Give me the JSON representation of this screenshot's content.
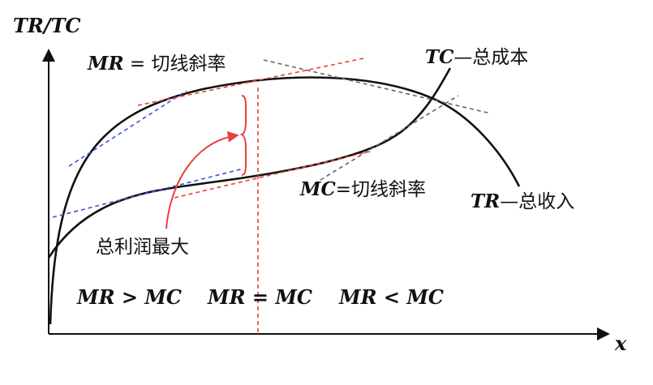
{
  "axes": {
    "y_label": "TR/TC",
    "x_label": "x"
  },
  "curves": {
    "tc_label_sym": "TC",
    "tc_label_text": "—总成本",
    "tr_label_sym": "TR",
    "tr_label_text": "—总收入"
  },
  "annotations": {
    "mr_tangent_sym": "MR",
    "mr_tangent_text": " = 切线斜率",
    "mc_tangent_sym": "MC",
    "mc_tangent_text": "=切线斜率",
    "max_profit": "总利润最大",
    "region_left": "MR > MC",
    "region_mid": "MR = MC",
    "region_right": "MR < MC"
  },
  "colors": {
    "axis": "#111111",
    "curve": "#111111",
    "red_tangent": "#e8403a",
    "blue_tangent": "#3a55d6",
    "gray_tangent": "#666666",
    "max_profit_line": "#e8403a"
  }
}
